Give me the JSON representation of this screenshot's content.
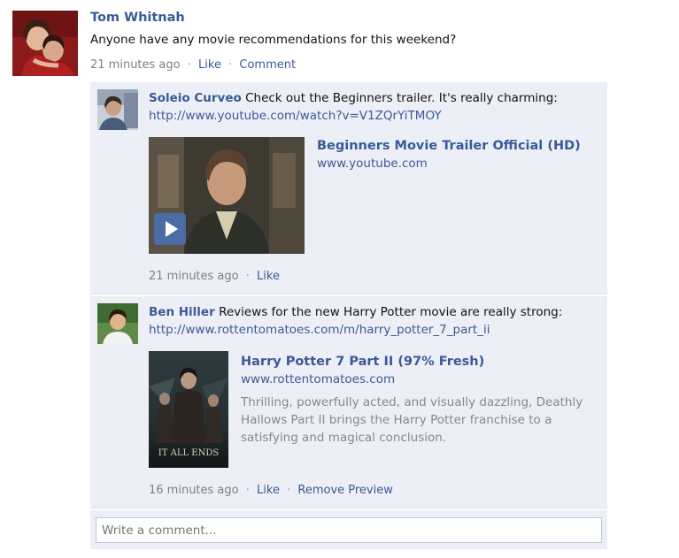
{
  "post": {
    "author": "Tom Whitnah",
    "text": "Anyone have any movie recommendations for this weekend?",
    "time": "21 minutes ago",
    "like_label": "Like",
    "comment_label": "Comment"
  },
  "comments": [
    {
      "author": "Soleio Curveo",
      "text": "Check out the Beginners trailer. It's really charming:",
      "url": "http://www.youtube.com/watch?v=V1ZQrYiTMOY",
      "preview": {
        "title": "Beginners Movie Trailer Official (HD)",
        "domain": "www.youtube.com",
        "description": ""
      },
      "time": "21 minutes ago",
      "actions": [
        "Like"
      ]
    },
    {
      "author": "Ben Hiller",
      "text": "Reviews for the new Harry Potter movie are really strong:",
      "url": "http://www.rottentomatoes.com/m/harry_potter_7_part_ii",
      "preview": {
        "title": "Harry Potter 7 Part II (97% Fresh)",
        "domain": "www.rottentomatoes.com",
        "description": "Thrilling, powerfully acted, and visually dazzling, Deathly Hallows Part II brings the Harry Potter franchise to a satisfying and magical conclusion.",
        "poster_text": "IT ALL ENDS"
      },
      "time": "16 minutes ago",
      "actions": [
        "Like",
        "Remove Preview"
      ]
    }
  ],
  "composer": {
    "placeholder": "Write a comment..."
  },
  "colors": {
    "link": "#3b5998",
    "meta": "#808080",
    "comment_bg": "#eceff5",
    "input_border": "#bdc7d8"
  },
  "icons": {
    "play": "play-icon"
  }
}
